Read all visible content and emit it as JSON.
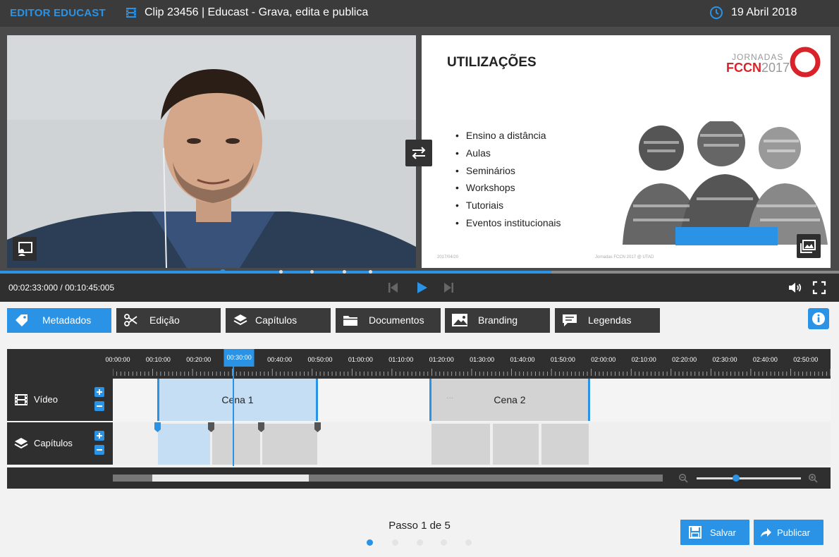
{
  "topbar": {
    "brand": "EDITOR EDUCAST",
    "clip_title": "Clip 23456 | Educast - Grava, edita e publica",
    "date": "19 Abril 2018"
  },
  "slide": {
    "title": "UTILIZAÇÕES",
    "logo_top": "JORNADAS",
    "logo_main": "FCCN",
    "logo_year": "2017",
    "bullets": [
      "Ensino a distância",
      "Aulas",
      "Seminários",
      "Workshops",
      "Tutoriais",
      "Eventos institucionais"
    ],
    "footer_left": "2017/04/20",
    "footer_center": "Jornadas FCCN 2017 @ UTAD"
  },
  "player": {
    "time": "00:02:33:000 / 00:10:45:005",
    "progress_fraction": 0.657
  },
  "tabs": [
    {
      "label": "Metadados",
      "icon": "tag-icon",
      "active": true
    },
    {
      "label": "Edição",
      "icon": "scissors-icon",
      "active": false
    },
    {
      "label": "Capítulos",
      "icon": "layers-icon",
      "active": false
    },
    {
      "label": "Documentos",
      "icon": "folder-icon",
      "active": false
    },
    {
      "label": "Branding",
      "icon": "image-icon",
      "active": false
    },
    {
      "label": "Legendas",
      "icon": "speech-bubble-icon",
      "active": false
    }
  ],
  "timeline": {
    "ticks": [
      "00:00:00",
      "00:10:00",
      "00:20:00",
      "00:30:00",
      "00:40:00",
      "00:50:00",
      "01:00:00",
      "01:10:00",
      "01:20:00",
      "01:30:00",
      "01:40:00",
      "01:50:00",
      "02:00:00",
      "02:10:00",
      "02:20:00",
      "02:30:00",
      "02:40:00",
      "02:50:00"
    ],
    "active_tick": "00:30:00",
    "tracks": {
      "video_label": "Vídeo",
      "chapters_label": "Capítulos"
    },
    "scenes": [
      "Cena 1",
      "Cena 2"
    ],
    "scene2_dots": "···",
    "zoom_fraction": 0.38
  },
  "footer": {
    "step": "Passo 1 de 5",
    "current_step": 1,
    "total_steps": 5,
    "save": "Salvar",
    "publish": "Publicar"
  },
  "colors": {
    "accent": "#2a93e6",
    "dark": "#2f2f2f",
    "selection": "#c5def3"
  }
}
